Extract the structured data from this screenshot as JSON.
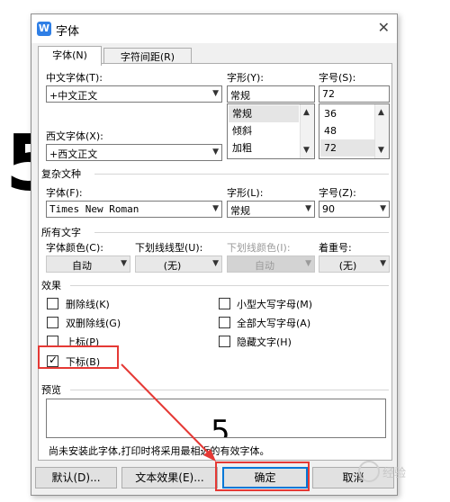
{
  "dialog": {
    "title": "字体",
    "app_icon_letter": "W",
    "close_symbol": "✕"
  },
  "tabs": [
    {
      "label": "字体(N)",
      "active": true
    },
    {
      "label": "字符间距(R)",
      "active": false
    }
  ],
  "chinese_font": {
    "label": "中文字体(T):",
    "value": "+中文正文"
  },
  "western_font": {
    "label": "西文字体(X):",
    "value": "+西文正文"
  },
  "font_style": {
    "label": "字形(Y):",
    "value": "常规",
    "options": [
      "常规",
      "倾斜",
      "加粗"
    ],
    "selected": "常规"
  },
  "font_size": {
    "label": "字号(S):",
    "value": "72",
    "options": [
      "36",
      "48",
      "72"
    ],
    "selected": "72"
  },
  "complex_script": {
    "group_title": "复杂文种",
    "font_label": "字体(F):",
    "font_value": "Times New Roman",
    "style_label": "字形(L):",
    "style_value": "常规",
    "size_label": "字号(Z):",
    "size_value": "90"
  },
  "all_text": {
    "group_title": "所有文字",
    "font_color_label": "字体颜色(C):",
    "font_color_value": "自动",
    "underline_type_label": "下划线线型(U):",
    "underline_type_value": "(无)",
    "underline_color_label": "下划线颜色(I):",
    "underline_color_value": "自动",
    "emphasis_label": "着重号:",
    "emphasis_value": "(无)"
  },
  "effects": {
    "group_title": "效果",
    "left": [
      {
        "label": "删除线(K)",
        "checked": false
      },
      {
        "label": "双删除线(G)",
        "checked": false
      },
      {
        "label": "上标(P)",
        "checked": false
      },
      {
        "label": "下标(B)",
        "checked": true
      }
    ],
    "right": [
      {
        "label": "小型大写字母(M)",
        "checked": false
      },
      {
        "label": "全部大写字母(A)",
        "checked": false
      },
      {
        "label": "隐藏文字(H)",
        "checked": false
      }
    ]
  },
  "preview": {
    "group_title": "预览",
    "sample_text": "5",
    "note": "尚未安装此字体,打印时将采用最相近的有效字体。"
  },
  "buttons": {
    "default": "默认(D)...",
    "text_effects": "文本效果(E)...",
    "ok": "确定",
    "cancel": "取消"
  },
  "background_glyph": "5",
  "watermark": {
    "text": "经验"
  },
  "colors": {
    "highlight_red": "#e53935",
    "app_icon_blue": "#2f7fe6",
    "focus_blue": "#0078d7"
  }
}
